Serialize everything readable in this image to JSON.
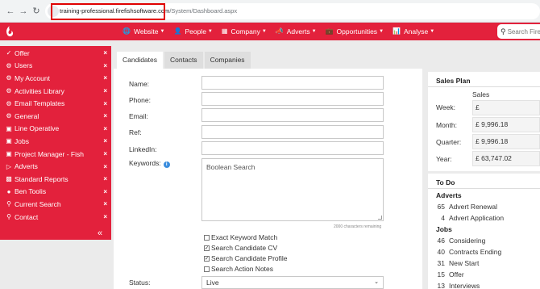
{
  "browser": {
    "back_icon": "arrow-left",
    "forward_icon": "arrow-right",
    "reload_icon": "reload",
    "url_host": "training-professional.firefishsoftware.com",
    "url_path": "/System/Dashboard.aspx"
  },
  "nav": {
    "items": [
      {
        "icon": "globe",
        "label": "Website"
      },
      {
        "icon": "people",
        "label": "People"
      },
      {
        "icon": "building",
        "label": "Company"
      },
      {
        "icon": "megaphone",
        "label": "Adverts"
      },
      {
        "icon": "briefcase",
        "label": "Opportunities"
      },
      {
        "icon": "bar-chart",
        "label": "Analyse"
      }
    ],
    "search_placeholder": "Search Firefish"
  },
  "sidebar": {
    "items": [
      {
        "icon": "check",
        "label": "Offer"
      },
      {
        "icon": "gear",
        "label": "Users"
      },
      {
        "icon": "gear",
        "label": "My Account"
      },
      {
        "icon": "gear",
        "label": "Activities Library"
      },
      {
        "icon": "gear",
        "label": "Email Templates"
      },
      {
        "icon": "gear",
        "label": "General"
      },
      {
        "icon": "briefcase",
        "label": "Line Operative"
      },
      {
        "icon": "briefcase",
        "label": "Jobs"
      },
      {
        "icon": "briefcase",
        "label": "Project Manager - Fish"
      },
      {
        "icon": "megaphone",
        "label": "Adverts"
      },
      {
        "icon": "bar-chart",
        "label": "Standard Reports"
      },
      {
        "icon": "people",
        "label": "Ben Toolis"
      },
      {
        "icon": "search",
        "label": "Current Search"
      },
      {
        "icon": "search",
        "label": "Contact"
      }
    ],
    "close_glyph": "×",
    "collapse_glyph": "«"
  },
  "tabs": [
    "Candidates",
    "Contacts",
    "Companies"
  ],
  "form": {
    "fields": [
      "Name:",
      "Phone:",
      "Email:",
      "Ref:",
      "LinkedIn:"
    ],
    "keywords_label": "Keywords:",
    "keywords_placeholder": "Boolean Search",
    "remaining": "2000 characters remaining",
    "checkboxes": [
      {
        "label": "Exact Keyword Match",
        "checked": false
      },
      {
        "label": "Search Candidate CV",
        "checked": true
      },
      {
        "label": "Search Candidate Profile",
        "checked": true
      },
      {
        "label": "Search Action Notes",
        "checked": false
      }
    ],
    "status_label": "Status:",
    "status_value": "Live"
  },
  "sales_plan": {
    "title": "Sales Plan",
    "column": "Sales",
    "rows": [
      {
        "label": "Week:",
        "value": "£"
      },
      {
        "label": "Month:",
        "value": "£ 9,996.18"
      },
      {
        "label": "Quarter:",
        "value": "£ 9,996.18"
      },
      {
        "label": "Year:",
        "value": "£ 63,747.02"
      }
    ]
  },
  "todo": {
    "title": "To Do",
    "sections": [
      {
        "name": "Adverts",
        "items": [
          {
            "count": "65",
            "label": "Advert Renewal"
          },
          {
            "count": "4",
            "label": "Advert Application"
          }
        ]
      },
      {
        "name": "Jobs",
        "items": [
          {
            "count": "46",
            "label": "Considering"
          },
          {
            "count": "40",
            "label": "Contracts Ending"
          },
          {
            "count": "31",
            "label": "New Start"
          },
          {
            "count": "15",
            "label": "Offer"
          },
          {
            "count": "13",
            "label": "Interviews"
          }
        ]
      }
    ]
  },
  "colors": {
    "brand": "#e3213c",
    "highlight": "#e00000"
  }
}
